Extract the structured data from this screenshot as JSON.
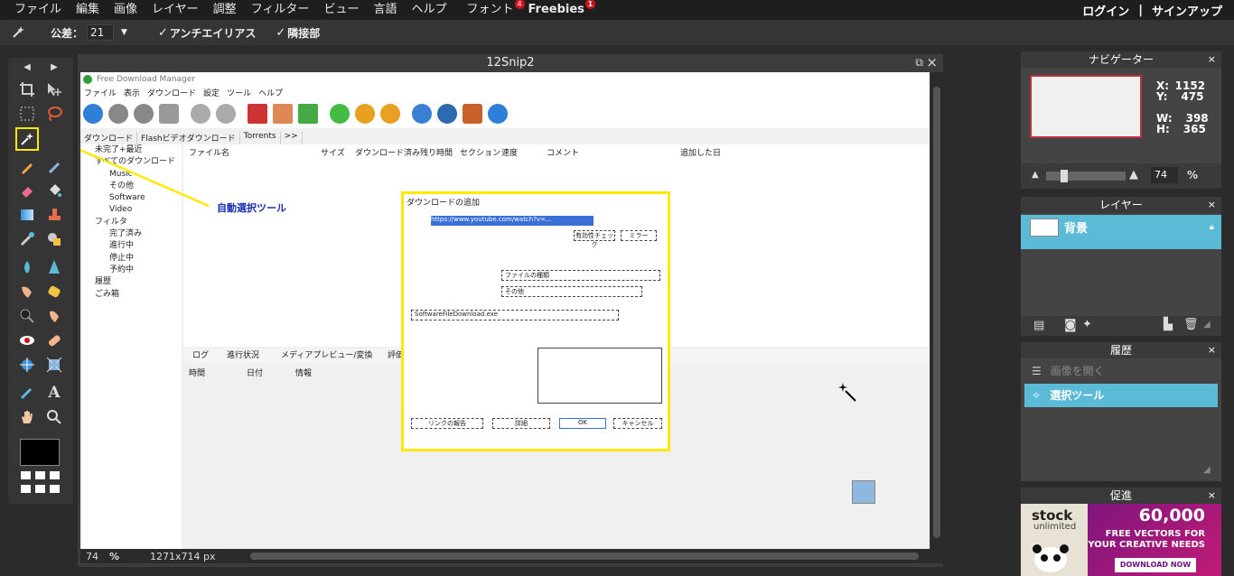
{
  "menubar": {
    "items": [
      {
        "label": "ファイル"
      },
      {
        "label": "編集"
      },
      {
        "label": "画像"
      },
      {
        "label": "レイヤー"
      },
      {
        "label": "調整"
      },
      {
        "label": "フィルター"
      },
      {
        "label": "ビュー"
      },
      {
        "label": "言語"
      },
      {
        "label": "ヘルプ"
      },
      {
        "label": "フォント",
        "badge": "4"
      },
      {
        "label": "Freebies",
        "badge": "1"
      }
    ],
    "login": "ログイン",
    "separator": "|",
    "signup": "サインアップ"
  },
  "options": {
    "tolerance_label": "公差：",
    "tolerance_value": "21",
    "antialias_label": "アンチエイリアス",
    "contiguous_label": "隣接部",
    "check_mark": "✓"
  },
  "document": {
    "title": "12Snip2",
    "zoom": "74",
    "zoom_unit": "%",
    "dimensions": "1271x714 px",
    "annotation": "自動選択ツール"
  },
  "fdm": {
    "window_title": "Free Download Manager",
    "menu": [
      "ファイル",
      "表示",
      "ダウンロード",
      "設定",
      "ツール",
      "ヘルプ"
    ],
    "tabs": [
      "ダウンロード",
      "Flashビデオダウンロード",
      "Torrents",
      ">>"
    ],
    "tree": [
      "未完了+最近",
      "すべてのダウンロード",
      "Music",
      "その他",
      "Software",
      "Video",
      "フィルタ",
      "完了済み",
      "進行中",
      "停止中",
      "予約中",
      "履歴",
      "ごみ箱"
    ],
    "columns": [
      "ファイル名",
      "サイズ",
      "ダウンロード済み",
      "残り時間",
      "セクション",
      "速度",
      "コメント",
      "追加した日"
    ],
    "lower_tabs": [
      "ログ",
      "進行状況",
      "メディアプレビュー/変換",
      "評価"
    ],
    "log_columns": [
      "時間",
      "日付",
      "情報"
    ],
    "dialog": {
      "title": "ダウンロードの追加",
      "url": "https://www.youtube.com/watch?v=...",
      "btn_check": "有効性チェック",
      "btn_copy": "ミラー",
      "category": "ファイルの種類",
      "folder": "その他",
      "filename": "SoftwareFileDownload.exe",
      "btn_ok": "OK",
      "btn_cancel": "キャンセル",
      "btn_report": "リンクの報告",
      "btn_detail": "詳細"
    }
  },
  "navigator": {
    "title": "ナビゲーター",
    "x_label": "X:",
    "x": "1152",
    "y_label": "Y:",
    "y": "475",
    "w_label": "W:",
    "w": "398",
    "h_label": "H:",
    "h": "365",
    "zoom": "74",
    "zoom_unit": "%"
  },
  "layers": {
    "title": "レイヤー",
    "items": [
      {
        "name": "背景"
      }
    ]
  },
  "history": {
    "title": "履歴",
    "items": [
      {
        "label": "画像を開く"
      },
      {
        "label": "選択ツール"
      }
    ]
  },
  "promo": {
    "title": "促進",
    "brand": "stock",
    "brand_sub": "unlimited",
    "count": "60,000",
    "headline1": "FREE VECTORS FOR",
    "headline2": "YOUR CREATIVE NEEDS",
    "cta": "DOWNLOAD NOW"
  },
  "close_glyph": "×",
  "colors": {
    "accent": "#5bbad6",
    "highlight": "#ffe900",
    "badge": "#d0131a",
    "promo_bg": "#b0197d"
  }
}
